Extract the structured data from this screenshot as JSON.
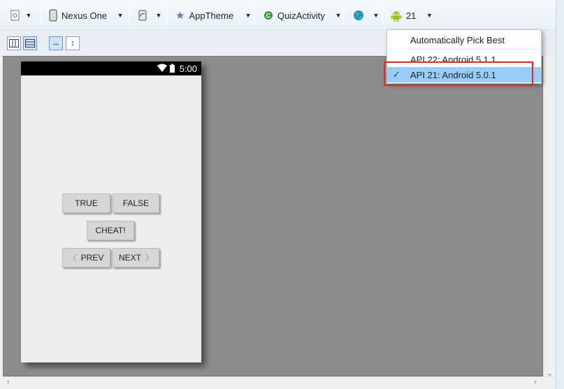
{
  "toolbar": {
    "device_label": "Nexus One",
    "theme_label": "AppTheme",
    "activity_label": "QuizActivity",
    "api_label": "21"
  },
  "phone": {
    "status_time": "5:00",
    "buttons": {
      "true_label": "TRUE",
      "false_label": "FALSE",
      "cheat_label": "CHEAT!",
      "prev_label": "PREV",
      "next_label": "NEXT"
    }
  },
  "api_dropdown": {
    "items": [
      {
        "label": "Automatically Pick Best",
        "selected": false
      },
      {
        "label": "API 22: Android 5.1.1",
        "selected": false
      },
      {
        "label": "API 21: Android 5.0.1",
        "selected": true
      }
    ]
  },
  "colors": {
    "selection": "#99ccf6",
    "highlight_box": "#e8262a",
    "canvas": "#8c8c8c",
    "android_green": "#97c024"
  }
}
